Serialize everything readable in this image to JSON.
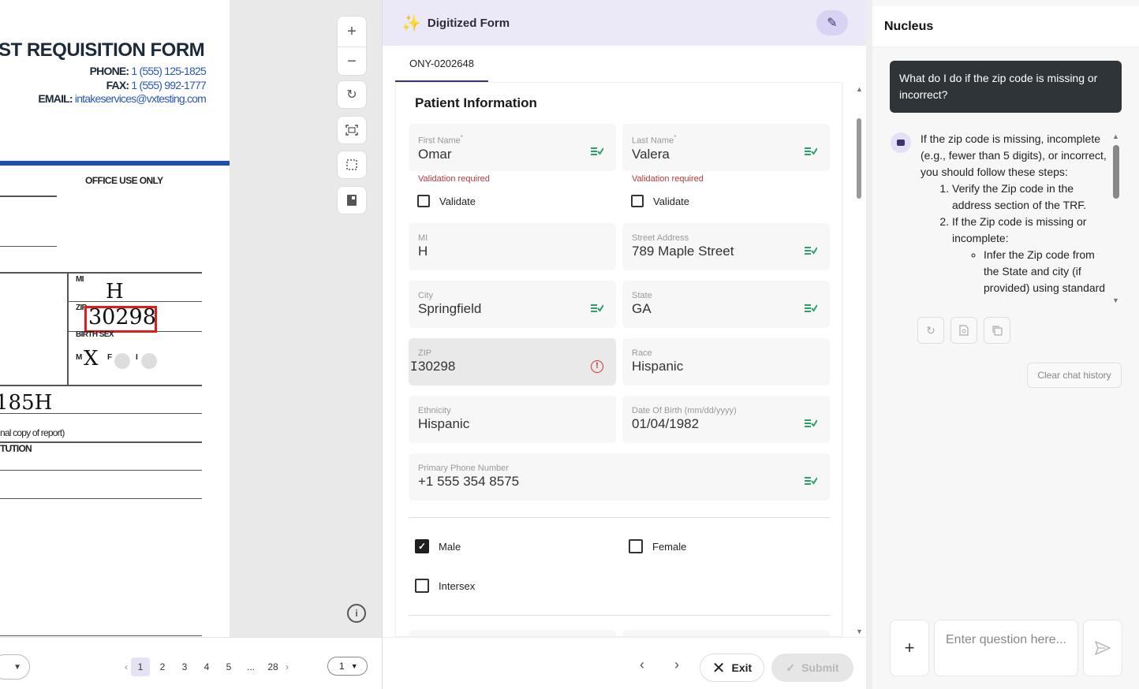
{
  "document": {
    "title": "ST REQUISITION FORM",
    "phone_label": "PHONE:",
    "phone": "1 (555) 125-1825",
    "fax_label": "FAX:",
    "fax": "1 (555) 992-1777",
    "email_label": "EMAIL:",
    "email": "intakeservices@vxtesting.com",
    "office_use": "OFFICE USE ONLY",
    "mi_label": "MI",
    "mi_value": "H",
    "zip_label": "ZIP",
    "zip_value": "30298",
    "birth_sex_label": "BIRTH SEX",
    "sex_m": "M",
    "sex_f": "F",
    "sex_i": "I",
    "handwritten_code": "185H",
    "copy_note": "nal copy of report)",
    "institution": "TUTION"
  },
  "viewer_controls": {
    "zoom_in": "+",
    "zoom_out": "−"
  },
  "pager": {
    "pages": [
      "1",
      "2",
      "3",
      "4",
      "5",
      "...",
      "28"
    ],
    "current_page": "1"
  },
  "form": {
    "header_title": "Digitized Form",
    "tab_label": "ONY-0202648",
    "section_title": "Patient Information",
    "first_name": {
      "label": "First Name",
      "value": "Omar",
      "validation": "Validation required",
      "validate_label": "Validate"
    },
    "last_name": {
      "label": "Last Name",
      "value": "Valera",
      "validation": "Validation required",
      "validate_label": "Validate"
    },
    "mi": {
      "label": "MI",
      "value": "H"
    },
    "street": {
      "label": "Street Address",
      "value": "789 Maple Street"
    },
    "city": {
      "label": "City",
      "value": "Springfield"
    },
    "state": {
      "label": "State",
      "value": "GA"
    },
    "zip": {
      "label": "ZIP",
      "value": "30298"
    },
    "race": {
      "label": "Race",
      "value": "Hispanic"
    },
    "ethnicity": {
      "label": "Ethnicity",
      "value": "Hispanic"
    },
    "dob": {
      "label": "Date Of Birth (mm/dd/yyyy)",
      "value": "01/04/1982"
    },
    "phone": {
      "label": "Primary Phone Number",
      "value": "+1 555 354 8575"
    },
    "sex_options": [
      {
        "label": "Male",
        "checked": true
      },
      {
        "label": "Female",
        "checked": false
      },
      {
        "label": "Intersex",
        "checked": false
      }
    ],
    "exit_label": "Exit",
    "submit_label": "Submit",
    "required_mark": "*"
  },
  "chat": {
    "title": "Nucleus",
    "user_message": "What do I do if the zip code is missing or incorrect?",
    "bot_intro": "If the zip code is missing, incomplete (e.g., fewer than 5 digits), or incorrect, you should follow these steps:",
    "bot_step1": "Verify the Zip code in the address section of the TRF.",
    "bot_step2": "If the Zip code is missing or incomplete:",
    "bot_substep": "Infer the Zip code from the State and city (if provided) using standard",
    "clear_label": "Clear chat history",
    "input_placeholder": "Enter question here..."
  },
  "colors": {
    "accent": "#3b3470",
    "header_bg": "#ebe9f8",
    "validation_red": "#b43a3a",
    "redline": "#e01b1b",
    "doc_blue": "#1f4fa8"
  }
}
